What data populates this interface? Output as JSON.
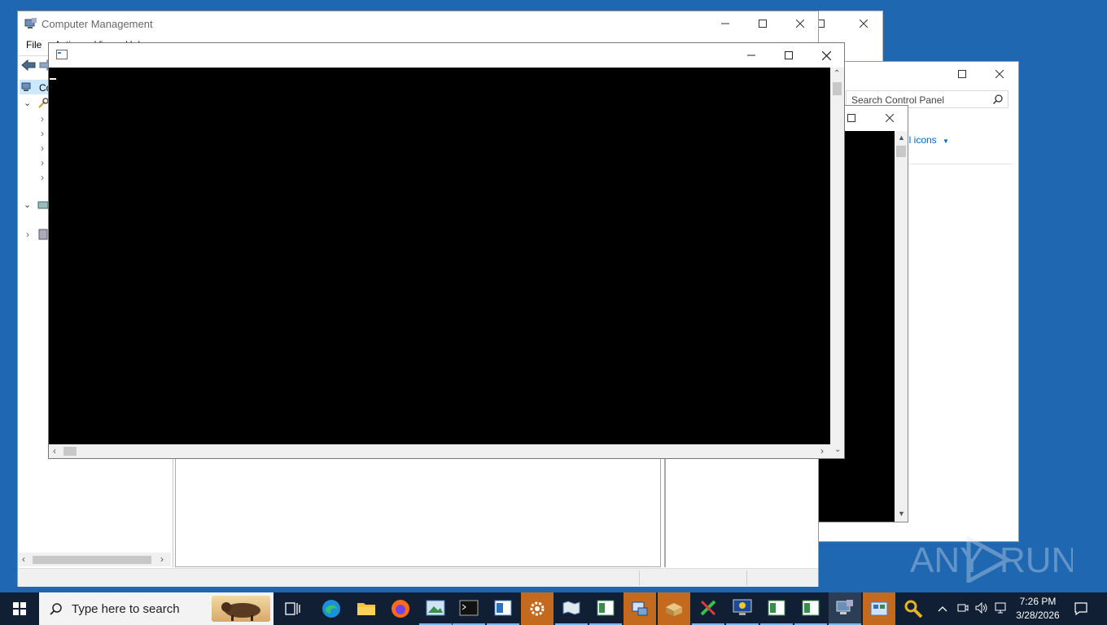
{
  "computer_management": {
    "title": "Computer Management",
    "menu": [
      "File",
      "Action",
      "View",
      "Help"
    ],
    "tree_root_label": "Co"
  },
  "control_panel": {
    "search_placeholder": "Search Control Panel",
    "view_by_value": "ll icons"
  },
  "console_window": {
    "title": ""
  },
  "watermark": "ANY RUN",
  "taskbar": {
    "search_placeholder": "Type here to search",
    "time": "7:26 PM",
    "date": "3/28/2026"
  },
  "colors": {
    "desktop": "#1f67b1",
    "taskbar": "#101f33",
    "console_bg": "#000000",
    "link_blue": "#0066cc",
    "highlight_orange": "#c46a1f"
  }
}
